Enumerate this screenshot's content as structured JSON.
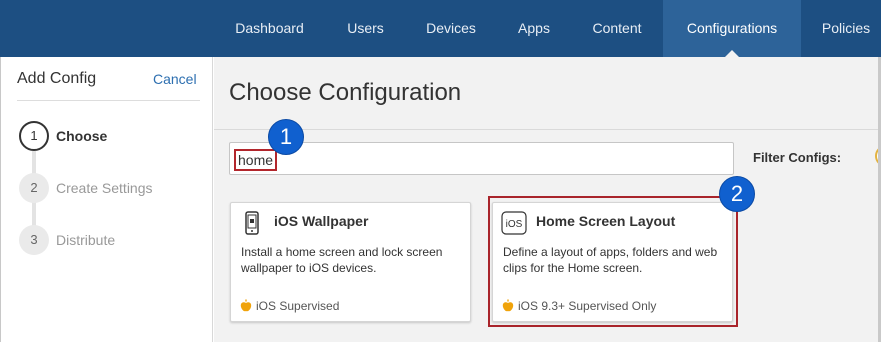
{
  "nav": {
    "items": [
      {
        "label": "Dashboard",
        "active": false
      },
      {
        "label": "Users",
        "active": false
      },
      {
        "label": "Devices",
        "active": false
      },
      {
        "label": "Apps",
        "active": false
      },
      {
        "label": "Content",
        "active": false
      },
      {
        "label": "Configurations",
        "active": true
      },
      {
        "label": "Policies",
        "active": false
      }
    ]
  },
  "sidebar": {
    "title": "Add Config",
    "cancel_label": "Cancel",
    "steps": [
      {
        "number": "1",
        "label": "Choose",
        "active": true
      },
      {
        "number": "2",
        "label": "Create Settings",
        "active": false
      },
      {
        "number": "3",
        "label": "Distribute",
        "active": false
      }
    ]
  },
  "main": {
    "title": "Choose Configuration",
    "search_value": "home",
    "filter_label": "Filter Configs:"
  },
  "annotations": {
    "badge_1": "1",
    "badge_2": "2"
  },
  "cards": [
    {
      "title": "iOS Wallpaper",
      "description": "Install a home screen and lock screen wallpaper to iOS devices.",
      "footer": "iOS Supervised",
      "icon": "phone-wallpaper-icon"
    },
    {
      "title": "Home Screen Layout",
      "icon_text": "iOS",
      "description": "Define a layout of apps, folders and web clips for the Home screen.",
      "footer": "iOS 9.3+ Supervised Only",
      "icon": "ios-badge-icon"
    }
  ],
  "colors": {
    "nav_bg": "#1d4f82",
    "nav_active": "#2d6399",
    "link": "#2d6fb0",
    "badge": "#1060cf",
    "highlight": "#a9242b",
    "apple_icon": "#f0a30a"
  }
}
